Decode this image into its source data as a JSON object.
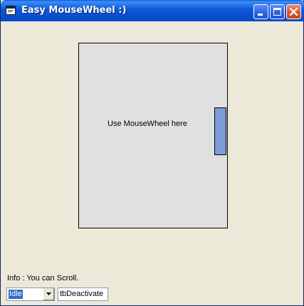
{
  "window": {
    "title": "Easy MouseWheel :)",
    "app_icon": "app-window-icon",
    "controls": [
      "minimize-icon",
      "maximize-icon",
      "close-icon"
    ]
  },
  "scroll_area": {
    "label": "Use MouseWheel here"
  },
  "status": {
    "info_text": "Info : You can Scroll."
  },
  "mode_select": {
    "value": "Idle"
  },
  "command_field": {
    "value": "tbDeactivate"
  },
  "colors": {
    "titlebar": "#0b58d8",
    "panel_bg": "#e0e0e0",
    "scroll_thumb": "#7f9ddb",
    "window_bg": "#ece9d8",
    "selection": "#316ac5"
  }
}
